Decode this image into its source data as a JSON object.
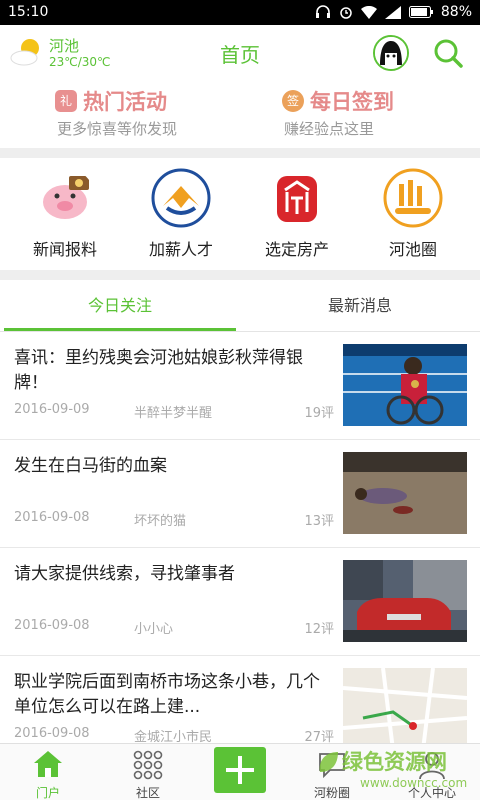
{
  "status": {
    "time": "15:10",
    "battery": "88%"
  },
  "header": {
    "city": "河池",
    "temp": "23℃/30℃",
    "title": "首页"
  },
  "promo": [
    {
      "badge": "礼",
      "title": "热门活动",
      "subtitle": "更多惊喜等你发现"
    },
    {
      "badge": "签",
      "title": "每日签到",
      "subtitle": "赚经验点这里"
    }
  ],
  "categories": [
    {
      "label": "新闻报料"
    },
    {
      "label": "加薪人才"
    },
    {
      "label": "选定房产"
    },
    {
      "label": "河池圈"
    }
  ],
  "tabs": [
    {
      "label": "今日关注"
    },
    {
      "label": "最新消息"
    }
  ],
  "news": [
    {
      "title": "喜讯：里约残奥会河池姑娘彭秋萍得银牌！",
      "date": "2016-09-09",
      "author": "半醉半梦半醒",
      "comments": "19评"
    },
    {
      "title": "发生在白马街的血案",
      "date": "2016-09-08",
      "author": "坏坏的猫",
      "comments": "13评"
    },
    {
      "title": "请大家提供线索，寻找肇事者",
      "date": "2016-09-08",
      "author": "小小心",
      "comments": "12评"
    },
    {
      "title": "职业学院后面到南桥市场这条小巷，几个单位怎么可以在路上建...",
      "date": "2016-09-08",
      "author": "金城江小市民",
      "comments": "27评"
    }
  ],
  "bottom_nav": [
    {
      "label": "门户"
    },
    {
      "label": "社区"
    },
    {
      "label": ""
    },
    {
      "label": "河粉圈"
    },
    {
      "label": "个人中心"
    }
  ],
  "watermark": {
    "text": "绿色资源网",
    "url": "www.downcc.com"
  },
  "colors": {
    "accent": "#5bc236",
    "promo": "#e58a8a"
  }
}
